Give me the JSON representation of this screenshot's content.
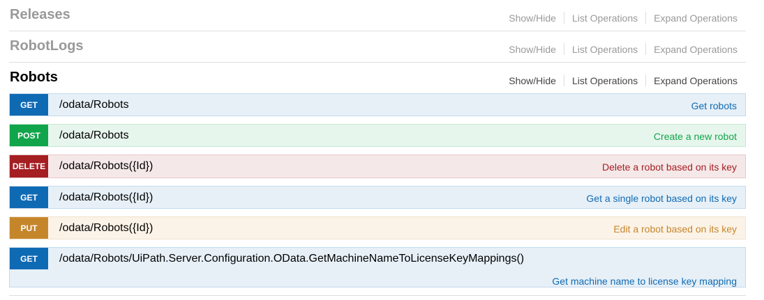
{
  "sections": [
    {
      "title": "Releases",
      "show_hide": "Show/Hide",
      "list_ops": "List Operations",
      "expand_ops": "Expand Operations"
    },
    {
      "title": "RobotLogs",
      "show_hide": "Show/Hide",
      "list_ops": "List Operations",
      "expand_ops": "Expand Operations"
    },
    {
      "title": "Robots",
      "show_hide": "Show/Hide",
      "list_ops": "List Operations",
      "expand_ops": "Expand Operations"
    }
  ],
  "operations": [
    {
      "method": "GET",
      "path": "/odata/Robots",
      "summary": "Get robots"
    },
    {
      "method": "POST",
      "path": "/odata/Robots",
      "summary": "Create a new robot"
    },
    {
      "method": "DELETE",
      "path": "/odata/Robots({Id})",
      "summary": "Delete a robot based on its key"
    },
    {
      "method": "GET",
      "path": "/odata/Robots({Id})",
      "summary": "Get a single robot based on its key"
    },
    {
      "method": "PUT",
      "path": "/odata/Robots({Id})",
      "summary": "Edit a robot based on its key"
    },
    {
      "method": "GET",
      "path": "/odata/Robots/UiPath.Server.Configuration.OData.GetMachineNameToLicenseKeyMappings()",
      "summary": "Get machine name to license key mapping"
    }
  ],
  "colors": {
    "get": "#0f6ab4",
    "post": "#10a54a",
    "delete": "#a41e22",
    "put": "#c5862b"
  }
}
